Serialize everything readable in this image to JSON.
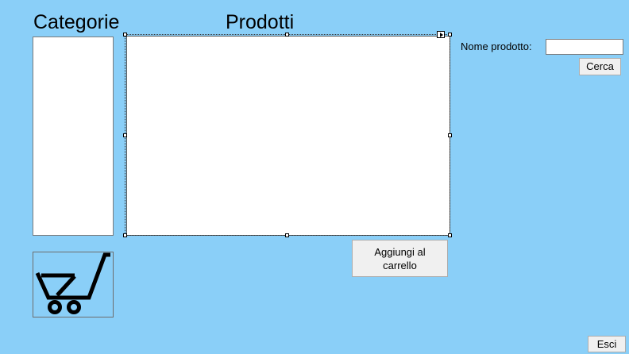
{
  "headings": {
    "categories": "Categorie",
    "products": "Prodotti"
  },
  "search": {
    "label": "Nome prodotto:",
    "value": "",
    "placeholder": "",
    "button_label": "Cerca"
  },
  "actions": {
    "add_to_cart_label": "Aggiungi al\ncarrello",
    "exit_label": "Esci"
  },
  "lists": {
    "categories_items": [],
    "products_items": []
  },
  "icons": {
    "cart": "shopping-cart-icon",
    "smart_tag": "smart-tag-arrow-icon"
  },
  "colors": {
    "background": "#8acff8",
    "list_background": "#ffffff",
    "button_face": "#f0f0f0"
  }
}
